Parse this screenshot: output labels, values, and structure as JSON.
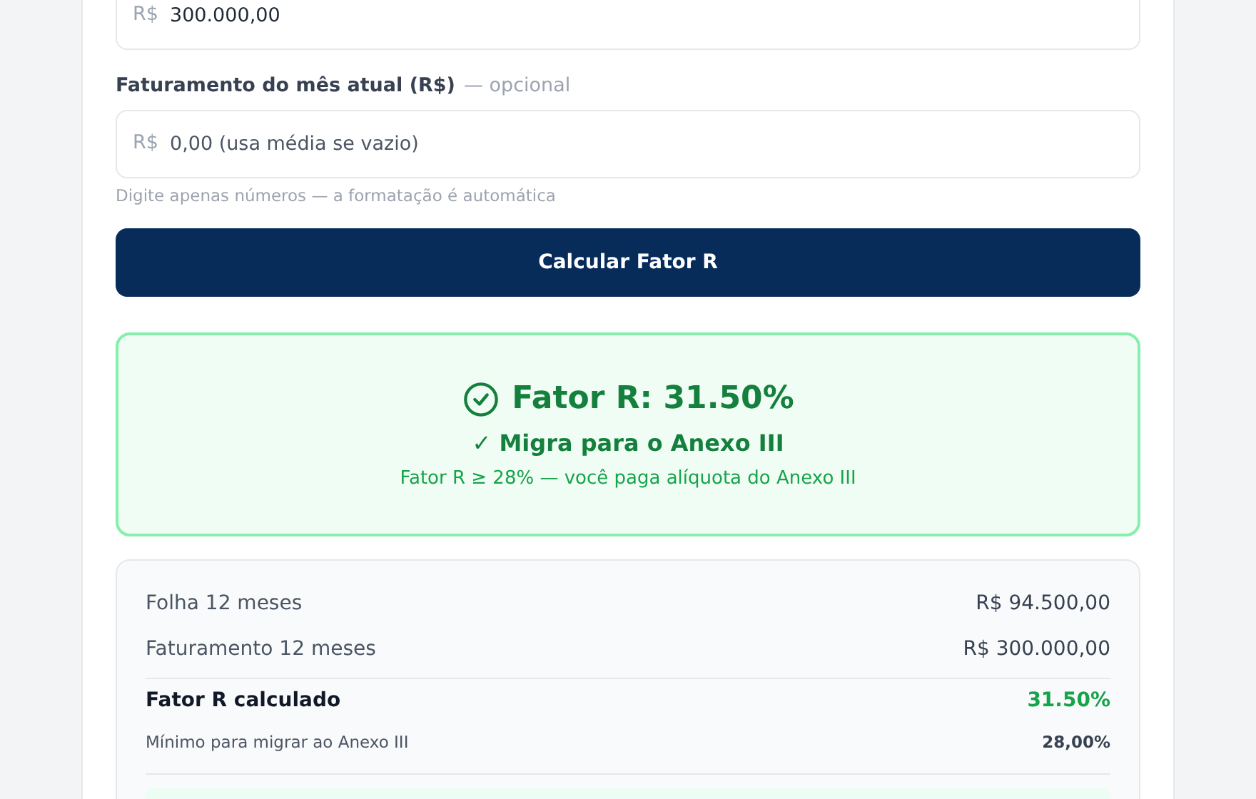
{
  "fields": [
    {
      "prefix": "R$",
      "value": "300.000,00"
    },
    {
      "label": "Faturamento do mês atual (R$)",
      "label_note": "— opcional",
      "prefix": "R$",
      "placeholder": "0,00 (usa média se vazio)",
      "hint": "Digite apenas números — a formatação é automática"
    }
  ],
  "button": "Calcular Fator R",
  "result": {
    "ok": true,
    "title": "Fator R: 31.50%",
    "verdict": "✓ Migra para o Anexo III",
    "detail": "Fator R ≥ 28% — você paga alíquota do Anexo III"
  },
  "summary": [
    {
      "kind": "normal",
      "label": "Folha 12 meses",
      "value": "R$ 94.500,00"
    },
    {
      "kind": "normal",
      "label": "Faturamento 12 meses",
      "value": "R$ 300.000,00"
    },
    {
      "kind": "total",
      "label": "Fator R calculado",
      "value": "31.50%"
    },
    {
      "kind": "note",
      "label": "Mínimo para migrar ao Anexo III",
      "value": "28,00%"
    }
  ]
}
